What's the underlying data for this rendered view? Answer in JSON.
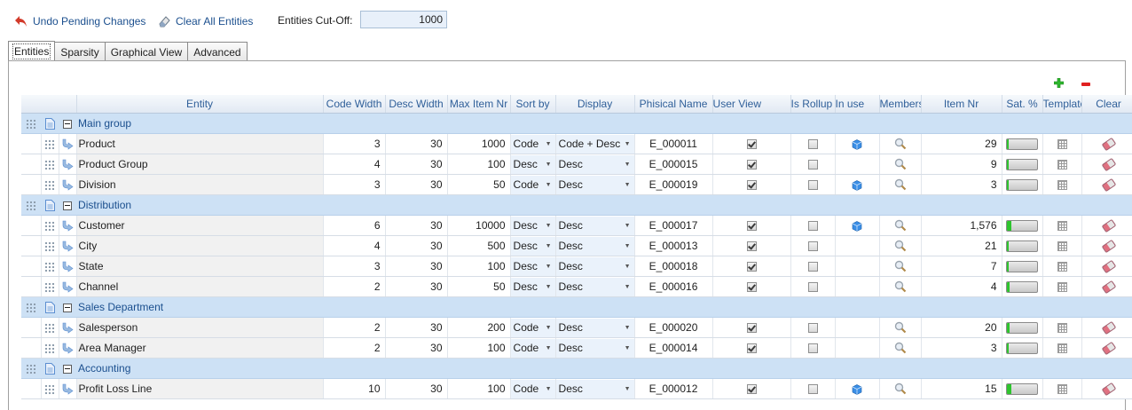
{
  "toolbar": {
    "undo_label": "Undo Pending Changes",
    "clear_label": "Clear All Entities",
    "cutoff_label": "Entities Cut-Off:",
    "cutoff_value": "1000"
  },
  "tabs": [
    {
      "label": "Entities",
      "active": true
    },
    {
      "label": "Sparsity",
      "active": false
    },
    {
      "label": "Graphical View",
      "active": false
    },
    {
      "label": "Advanced",
      "active": false
    }
  ],
  "columns": {
    "entity": "Entity",
    "code_width": "Code Width",
    "desc_width": "Desc Width",
    "max_item_nr": "Max Item Nr",
    "sort_by": "Sort by",
    "display": "Display",
    "phisical_name": "Phisical Name",
    "user_view": "User View",
    "is_rollup": "Is Rollup",
    "in_use": "In use",
    "members": "Members",
    "item_nr": "Item Nr",
    "sat": "Sat. %",
    "template": "Template",
    "clear": "Clear"
  },
  "groups": [
    {
      "name": "Main group",
      "rows": [
        {
          "entity": "Product",
          "code_width": "3",
          "desc_width": "30",
          "max_item_nr": "1000",
          "sort_by": "Code",
          "display": "Code + Desc",
          "phisical_name": "E_000011",
          "user_view": true,
          "is_rollup": false,
          "in_use": true,
          "item_nr": "29",
          "sat": 0.04
        },
        {
          "entity": "Product Group",
          "code_width": "4",
          "desc_width": "30",
          "max_item_nr": "100",
          "sort_by": "Desc",
          "display": "Desc",
          "phisical_name": "E_000015",
          "user_view": true,
          "is_rollup": false,
          "in_use": false,
          "item_nr": "9",
          "sat": 0.06
        },
        {
          "entity": "Division",
          "code_width": "3",
          "desc_width": "30",
          "max_item_nr": "50",
          "sort_by": "Code",
          "display": "Desc",
          "phisical_name": "E_000019",
          "user_view": true,
          "is_rollup": false,
          "in_use": true,
          "item_nr": "3",
          "sat": 0.06
        }
      ]
    },
    {
      "name": "Distribution",
      "rows": [
        {
          "entity": "Customer",
          "code_width": "6",
          "desc_width": "30",
          "max_item_nr": "10000",
          "sort_by": "Desc",
          "display": "Desc",
          "phisical_name": "E_000017",
          "user_view": true,
          "is_rollup": false,
          "in_use": true,
          "item_nr": "1,576",
          "sat": 0.16
        },
        {
          "entity": "City",
          "code_width": "4",
          "desc_width": "30",
          "max_item_nr": "500",
          "sort_by": "Desc",
          "display": "Desc",
          "phisical_name": "E_000013",
          "user_view": true,
          "is_rollup": false,
          "in_use": false,
          "item_nr": "21",
          "sat": 0.04
        },
        {
          "entity": "State",
          "code_width": "3",
          "desc_width": "30",
          "max_item_nr": "100",
          "sort_by": "Desc",
          "display": "Desc",
          "phisical_name": "E_000018",
          "user_view": true,
          "is_rollup": false,
          "in_use": false,
          "item_nr": "7",
          "sat": 0.07
        },
        {
          "entity": "Channel",
          "code_width": "2",
          "desc_width": "30",
          "max_item_nr": "50",
          "sort_by": "Desc",
          "display": "Desc",
          "phisical_name": "E_000016",
          "user_view": true,
          "is_rollup": false,
          "in_use": false,
          "item_nr": "4",
          "sat": 0.08
        }
      ]
    },
    {
      "name": "Sales Department",
      "rows": [
        {
          "entity": "Salesperson",
          "code_width": "2",
          "desc_width": "30",
          "max_item_nr": "200",
          "sort_by": "Code",
          "display": "Desc",
          "phisical_name": "E_000020",
          "user_view": true,
          "is_rollup": false,
          "in_use": false,
          "item_nr": "20",
          "sat": 0.1
        },
        {
          "entity": "Area Manager",
          "code_width": "2",
          "desc_width": "30",
          "max_item_nr": "100",
          "sort_by": "Code",
          "display": "Desc",
          "phisical_name": "E_000014",
          "user_view": true,
          "is_rollup": false,
          "in_use": false,
          "item_nr": "3",
          "sat": 0.03
        }
      ]
    },
    {
      "name": "Accounting",
      "rows": [
        {
          "entity": "Profit Loss Line",
          "code_width": "10",
          "desc_width": "30",
          "max_item_nr": "100",
          "sort_by": "Code",
          "display": "Desc",
          "phisical_name": "E_000012",
          "user_view": true,
          "is_rollup": false,
          "in_use": true,
          "item_nr": "15",
          "sat": 0.15
        }
      ]
    }
  ],
  "colors": {
    "accent": "#1b4f8e",
    "group_bg": "#cde1f5",
    "sat_fill": "#2ec42e",
    "add": "#2eb82e",
    "remove": "#e02020"
  }
}
